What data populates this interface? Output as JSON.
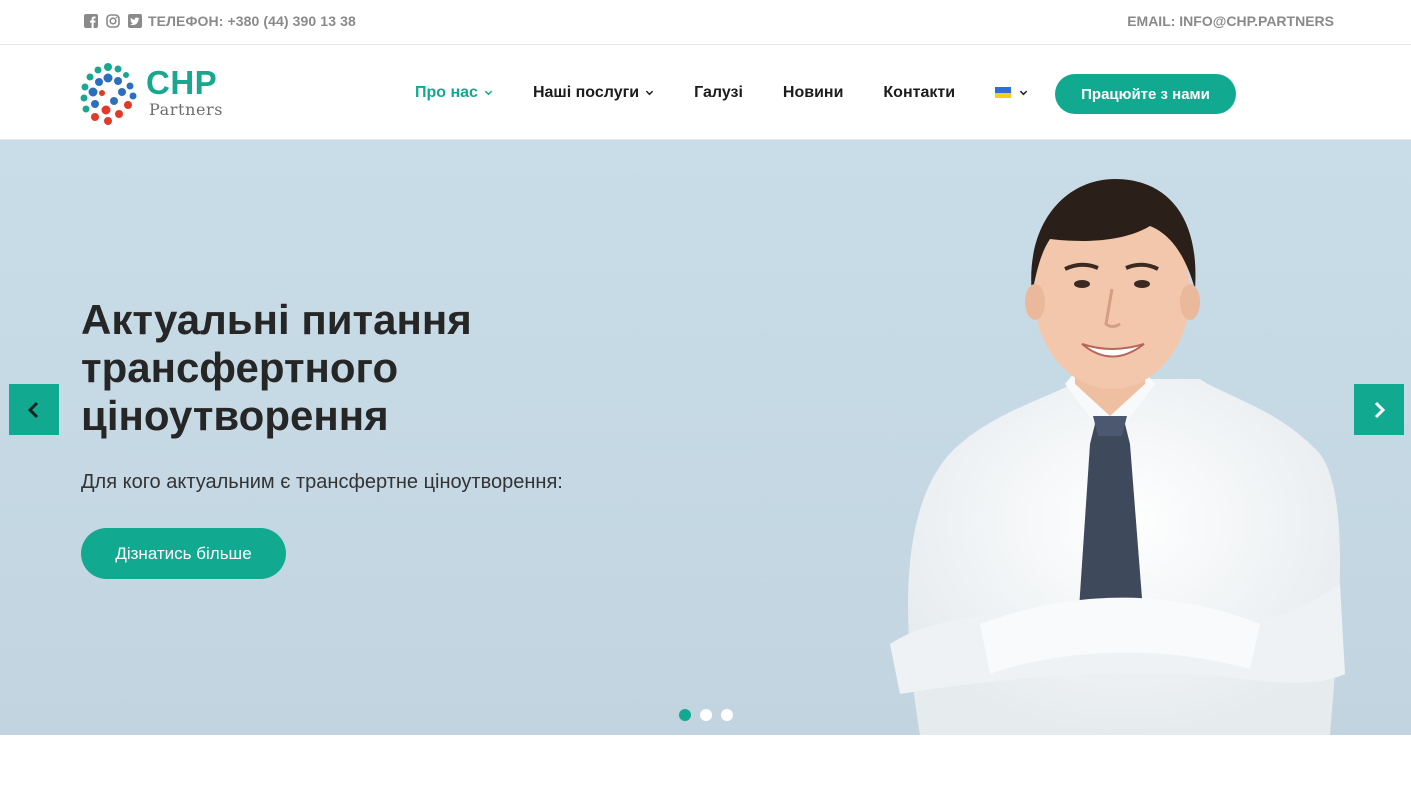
{
  "topbar": {
    "phone": "ТЕЛЕФОН: +380 (44) 390 13 38",
    "email": "EMAIL: INFO@CHP.PARTNERS",
    "social_icons": [
      "facebook-icon",
      "instagram-icon",
      "twitter-icon"
    ]
  },
  "header": {
    "logo_word": "CHP",
    "logo_sub": "Partners",
    "nav": [
      {
        "label": "Про нас",
        "has_dropdown": true,
        "active": true
      },
      {
        "label": "Наші послуги",
        "has_dropdown": true,
        "active": false
      },
      {
        "label": "Галузі",
        "has_dropdown": false,
        "active": false
      },
      {
        "label": "Новини",
        "has_dropdown": false,
        "active": false
      },
      {
        "label": "Контакти",
        "has_dropdown": false,
        "active": false
      }
    ],
    "language_icon": "ukraine-flag-icon",
    "cta_label": "Працюйте з нами"
  },
  "hero": {
    "title": "Актуальні питання трансфертного ціноутворення",
    "subtitle": "Для кого актуальним є трансфертне ціноутворення:",
    "button_label": "Дізнатись більше",
    "slide_count": 3,
    "active_slide": 1
  },
  "colors": {
    "accent": "#11a98f",
    "hero_bg": "#c9dde8",
    "muted_text": "#8a8a8a"
  }
}
